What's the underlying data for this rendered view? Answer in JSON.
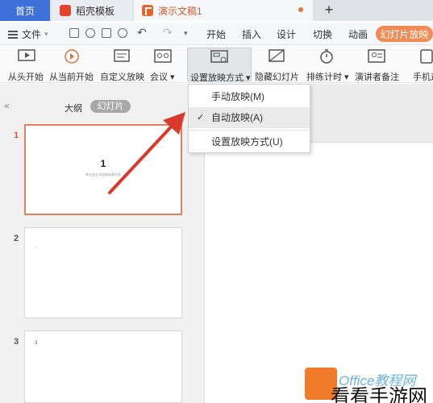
{
  "tabs": {
    "home": "首页",
    "template": "稻壳模板",
    "document": "演示文稿1",
    "new_tab": "+"
  },
  "menu": {
    "file": "文件",
    "items": [
      "开始",
      "插入",
      "设计",
      "切换",
      "动画"
    ],
    "active": "幻灯片放映"
  },
  "ribbon": {
    "from_start": "从头开始",
    "from_current": "从当前开始",
    "custom_show": "自定义放映",
    "meeting": "会议 ▾",
    "setup_show": "设置放映方式 ▾",
    "hide_slide": "隐藏幻灯片",
    "rehearse": "排练计时 ▾",
    "presenter_notes": "演讲者备注",
    "phone": "手机遥"
  },
  "panel": {
    "collapse": "«",
    "outline": "大纲",
    "slides": "幻灯片"
  },
  "slides": [
    {
      "number": "1",
      "title": "1",
      "subtitle": "单击此处添加副标题内容"
    },
    {
      "number": "2",
      "text": "·"
    },
    {
      "number": "3",
      "text": "3"
    }
  ],
  "dropdown": {
    "manual": "手动放映(M)",
    "auto": "自动放映(A)",
    "check": "✓",
    "setup": "设置放映方式(U)"
  },
  "watermark": {
    "office": "Office教程网",
    "site": "看看手游网"
  }
}
